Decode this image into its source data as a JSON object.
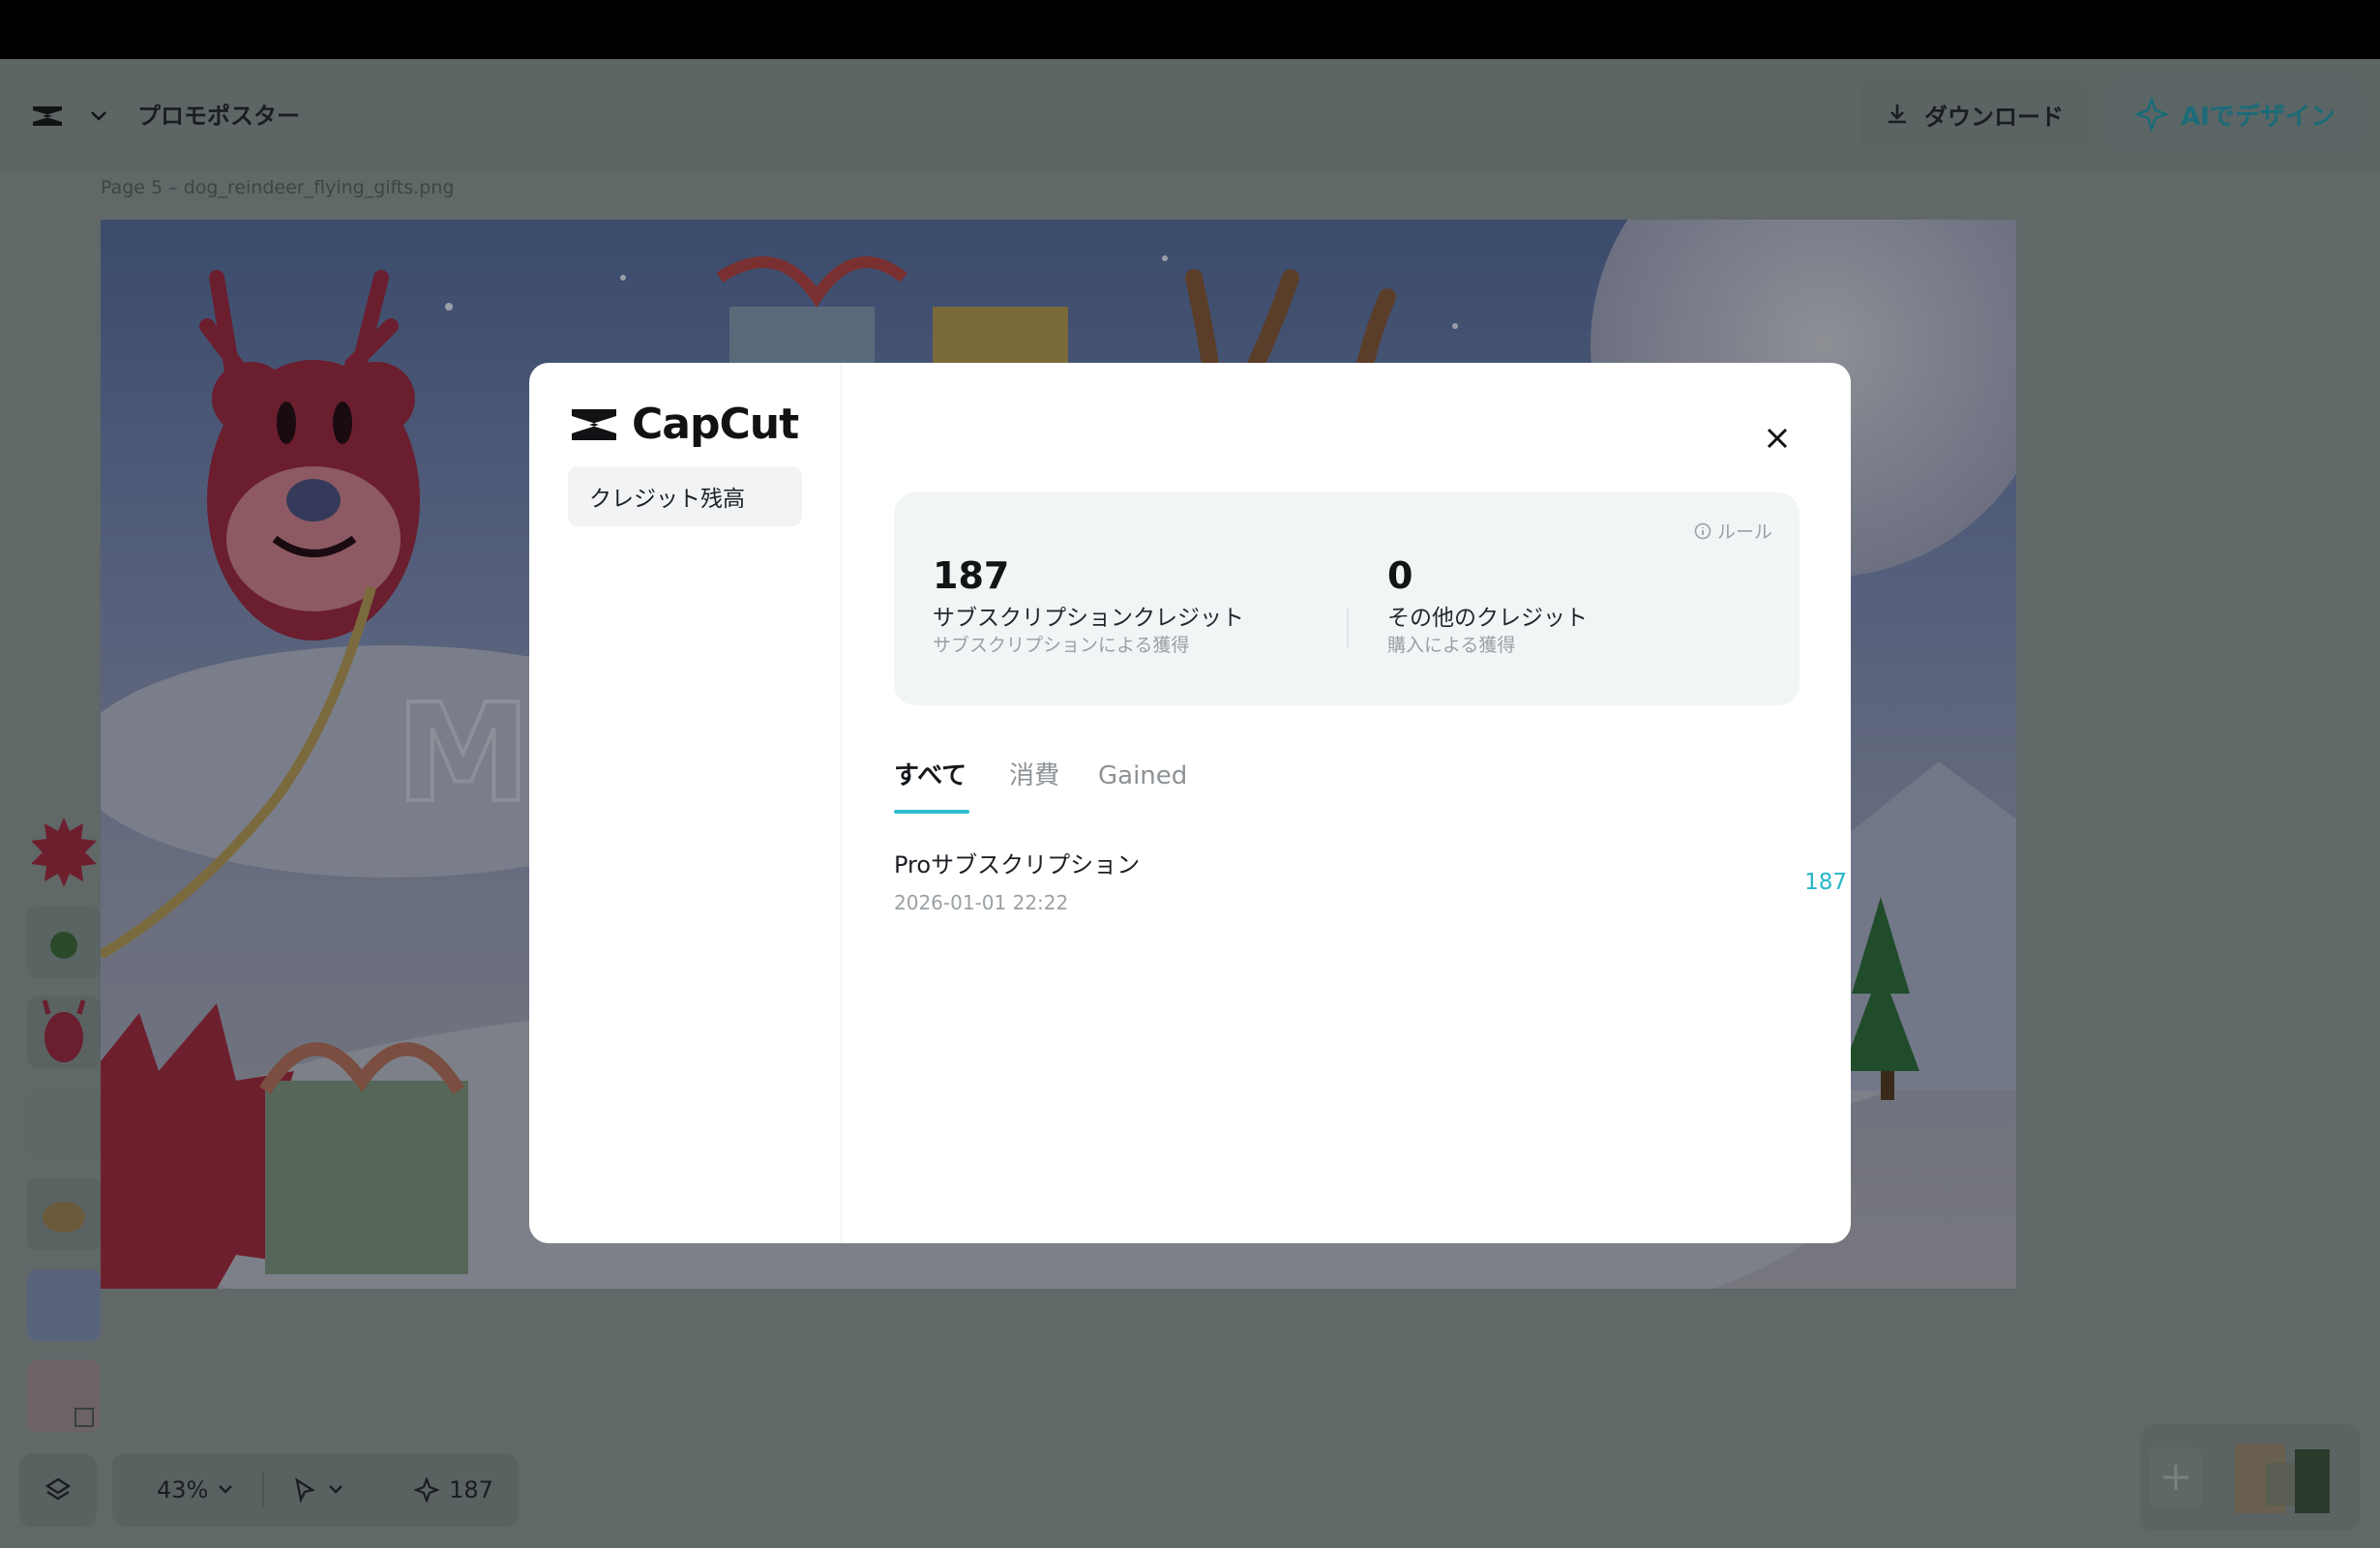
{
  "app": {
    "project_title": "プロモポスター",
    "page_label": "Page 5 –  dog_reindeer_flying_gifts.png",
    "download_label": "ダウンロード",
    "ai_design_label": "AIでデザイン",
    "canvas_letter": "M"
  },
  "bottom_bar": {
    "zoom": "43%",
    "credits": "187"
  },
  "modal": {
    "brand": "CapCut",
    "side_item": "クレジット残高",
    "rule_label": "ルール",
    "subscription": {
      "value": "187",
      "title": "サブスクリプションクレジット",
      "subtitle": "サブスクリプションによる獲得"
    },
    "other": {
      "value": "0",
      "title": "その他のクレジット",
      "subtitle": "購入による獲得"
    },
    "tabs": [
      {
        "label": "すべて",
        "active": true
      },
      {
        "label": "消費",
        "active": false
      },
      {
        "label": "Gained",
        "active": false
      }
    ],
    "transactions": [
      {
        "title": "Proサブスクリプション",
        "date": "2026-01-01 22:22",
        "value": "187"
      }
    ]
  },
  "colors": {
    "accent": "#2ec0d2",
    "overlay": "#606868",
    "modal_bg": "#ffffff"
  }
}
